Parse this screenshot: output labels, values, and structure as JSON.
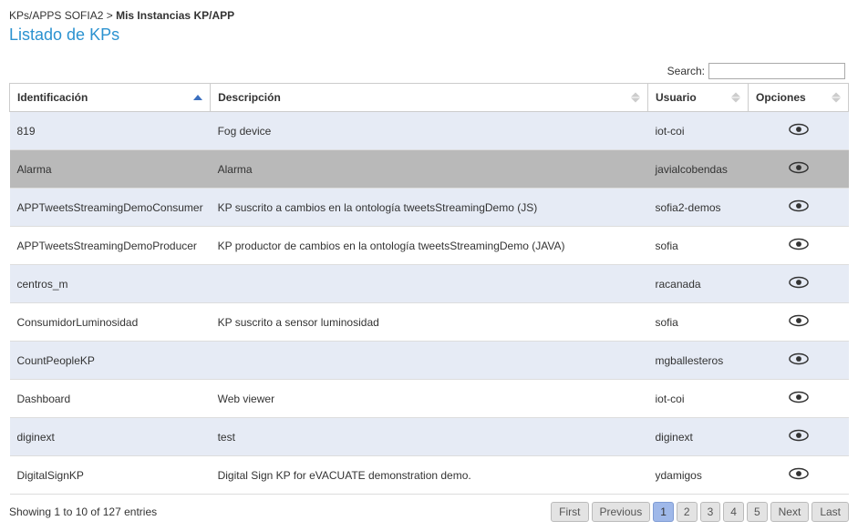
{
  "breadcrumb": {
    "parent": "KPs/APPS SOFIA2",
    "separator": ">",
    "current": "Mis Instancias KP/APP"
  },
  "page_title": "Listado de KPs",
  "search": {
    "label": "Search:",
    "value": ""
  },
  "columns": {
    "id": "Identificación",
    "desc": "Descripción",
    "user": "Usuario",
    "opt": "Opciones"
  },
  "rows": [
    {
      "id": "819",
      "desc": "Fog device",
      "user": "iot-coi",
      "selected": false
    },
    {
      "id": "Alarma",
      "desc": "Alarma",
      "user": "javialcobendas",
      "selected": true
    },
    {
      "id": "APPTweetsStreamingDemoConsumer",
      "desc": "KP suscrito a cambios en la ontología tweetsStreamingDemo (JS)",
      "user": "sofia2-demos",
      "selected": false
    },
    {
      "id": "APPTweetsStreamingDemoProducer",
      "desc": "KP productor de cambios en la ontología tweetsStreamingDemo (JAVA)",
      "user": "sofia",
      "selected": false
    },
    {
      "id": "centros_m",
      "desc": "",
      "user": "racanada",
      "selected": false
    },
    {
      "id": "ConsumidorLuminosidad",
      "desc": "KP suscrito a sensor luminosidad",
      "user": "sofia",
      "selected": false
    },
    {
      "id": "CountPeopleKP",
      "desc": "",
      "user": "mgballesteros",
      "selected": false
    },
    {
      "id": "Dashboard",
      "desc": "Web viewer",
      "user": "iot-coi",
      "selected": false
    },
    {
      "id": "diginext",
      "desc": "test",
      "user": "diginext",
      "selected": false
    },
    {
      "id": "DigitalSignKP",
      "desc": "Digital Sign KP for eVACUATE demonstration demo.",
      "user": "ydamigos",
      "selected": false
    }
  ],
  "footer": {
    "info": "Showing 1 to 10 of 127 entries",
    "pager": {
      "first": "First",
      "previous": "Previous",
      "pages": [
        "1",
        "2",
        "3",
        "4",
        "5"
      ],
      "active": "1",
      "next": "Next",
      "last": "Last"
    }
  }
}
